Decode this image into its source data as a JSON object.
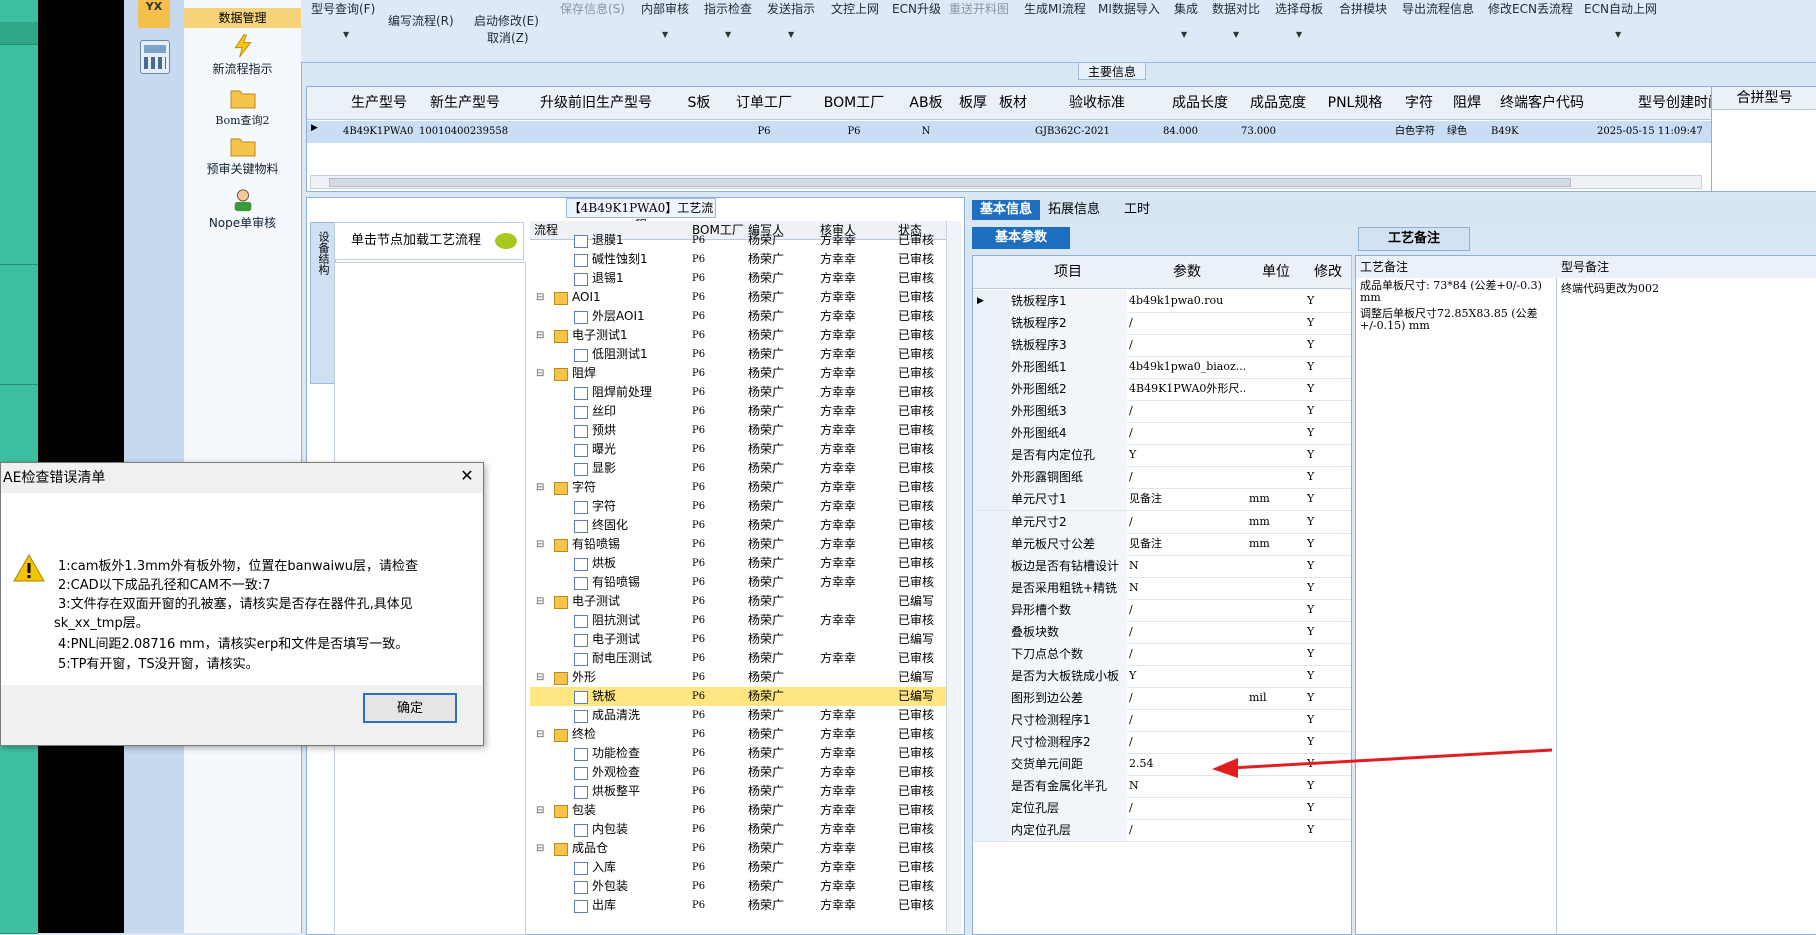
{
  "nav": {
    "top_label": "数据管理",
    "items": [
      {
        "label": "新流程指示",
        "icon": "lightning-icon"
      },
      {
        "label": "Bom查询2",
        "icon": "folder-icon"
      },
      {
        "label": "预审关键物料",
        "icon": "folder-icon"
      },
      {
        "label": "Nope单审核",
        "icon": "user-icon"
      }
    ]
  },
  "toolbar": {
    "model_query": "型号查询(F)",
    "edit_flow": "编写流程(R)",
    "start_edit": "启动修改(E)",
    "cancel": "取消(Z)",
    "save_info": "保存信息(S)",
    "internal_review": "内部审核",
    "indicator_check": "指示检查",
    "send_indicator": "发送指示",
    "doc_upload": "文控上网",
    "ecn_upgrade": "ECN升级",
    "resend_drill": "重送开料图",
    "gen_mi_flow": "生成MI流程",
    "mi_import": "MI数据导入",
    "integrate": "集成",
    "data_compare": "数据对比",
    "select_board": "选择母板",
    "merge_module": "合拼模块",
    "export_flow": "导出流程信息",
    "fix_ecn": "修改ECN丢流程",
    "ecn_auto": "ECN自动上网"
  },
  "main_info": {
    "title": "主要信息",
    "merge_label": "合拼型号",
    "headers": [
      "生产型号",
      "新生产型号",
      "升级前旧生产型号",
      "S板",
      "订单工厂",
      "BOM工厂",
      "AB板",
      "板厚",
      "板材",
      "验收标准",
      "成品长度",
      "成品宽度",
      "PNL规格",
      "字符",
      "阻焊",
      "终端客户代码",
      "型号创建时间"
    ],
    "row": [
      "4B49K1PWA0",
      "10010400239558",
      "",
      "",
      "P6",
      "P6",
      "N",
      "",
      "",
      "GJB362C-2021",
      "84.000",
      "73.000",
      "",
      "白色字符",
      "绿色",
      "B49K",
      "2025-05-15 11:09:47"
    ]
  },
  "process": {
    "title": "【4B49K1PWA0】工艺流程",
    "side_tab": "设备结构",
    "node_hint": "单击节点加载工艺流程",
    "headers": [
      "流程",
      "BOM工厂",
      "编写人",
      "核审人",
      "状态"
    ],
    "rows": [
      {
        "name": "退膜1",
        "level": 2,
        "factory": "P6",
        "writer": "杨荣广",
        "reviewer": "方幸幸",
        "status": "已审核"
      },
      {
        "name": "碱性蚀刻1",
        "level": 2,
        "factory": "P6",
        "writer": "杨荣广",
        "reviewer": "方幸幸",
        "status": "已审核"
      },
      {
        "name": "退锡1",
        "level": 2,
        "factory": "P6",
        "writer": "杨荣广",
        "reviewer": "方幸幸",
        "status": "已审核"
      },
      {
        "name": "AOI1",
        "level": 1,
        "factory": "P6",
        "writer": "杨荣广",
        "reviewer": "方幸幸",
        "status": "已审核"
      },
      {
        "name": "外层AOI1",
        "level": 2,
        "factory": "P6",
        "writer": "杨荣广",
        "reviewer": "方幸幸",
        "status": "已审核"
      },
      {
        "name": "电子测试1",
        "level": 1,
        "factory": "P6",
        "writer": "杨荣广",
        "reviewer": "方幸幸",
        "status": "已审核"
      },
      {
        "name": "低阻测试1",
        "level": 2,
        "factory": "P6",
        "writer": "杨荣广",
        "reviewer": "方幸幸",
        "status": "已审核"
      },
      {
        "name": "阻焊",
        "level": 1,
        "factory": "P6",
        "writer": "杨荣广",
        "reviewer": "方幸幸",
        "status": "已审核"
      },
      {
        "name": "阻焊前处理",
        "level": 2,
        "factory": "P6",
        "writer": "杨荣广",
        "reviewer": "方幸幸",
        "status": "已审核"
      },
      {
        "name": "丝印",
        "level": 2,
        "factory": "P6",
        "writer": "杨荣广",
        "reviewer": "方幸幸",
        "status": "已审核"
      },
      {
        "name": "预烘",
        "level": 2,
        "factory": "P6",
        "writer": "杨荣广",
        "reviewer": "方幸幸",
        "status": "已审核"
      },
      {
        "name": "曝光",
        "level": 2,
        "factory": "P6",
        "writer": "杨荣广",
        "reviewer": "方幸幸",
        "status": "已审核"
      },
      {
        "name": "显影",
        "level": 2,
        "factory": "P6",
        "writer": "杨荣广",
        "reviewer": "方幸幸",
        "status": "已审核"
      },
      {
        "name": "字符",
        "level": 1,
        "factory": "P6",
        "writer": "杨荣广",
        "reviewer": "方幸幸",
        "status": "已审核"
      },
      {
        "name": "字符",
        "level": 2,
        "factory": "P6",
        "writer": "杨荣广",
        "reviewer": "方幸幸",
        "status": "已审核"
      },
      {
        "name": "终固化",
        "level": 2,
        "factory": "P6",
        "writer": "杨荣广",
        "reviewer": "方幸幸",
        "status": "已审核"
      },
      {
        "name": "有铅喷锡",
        "level": 1,
        "factory": "P6",
        "writer": "杨荣广",
        "reviewer": "方幸幸",
        "status": "已审核"
      },
      {
        "name": "烘板",
        "level": 2,
        "factory": "P6",
        "writer": "杨荣广",
        "reviewer": "方幸幸",
        "status": "已审核"
      },
      {
        "name": "有铅喷锡",
        "level": 2,
        "factory": "P6",
        "writer": "杨荣广",
        "reviewer": "方幸幸",
        "status": "已审核"
      },
      {
        "name": "电子测试",
        "level": 1,
        "factory": "P6",
        "writer": "杨荣广",
        "reviewer": "",
        "status": "已编写"
      },
      {
        "name": "阻抗测试",
        "level": 2,
        "factory": "P6",
        "writer": "杨荣广",
        "reviewer": "方幸幸",
        "status": "已审核"
      },
      {
        "name": "电子测试",
        "level": 2,
        "factory": "P6",
        "writer": "杨荣广",
        "reviewer": "",
        "status": "已编写"
      },
      {
        "name": "耐电压测试",
        "level": 2,
        "factory": "P6",
        "writer": "杨荣广",
        "reviewer": "方幸幸",
        "status": "已审核"
      },
      {
        "name": "外形",
        "level": 1,
        "factory": "P6",
        "writer": "杨荣广",
        "reviewer": "",
        "status": "已编写"
      },
      {
        "name": "铣板",
        "level": 2,
        "factory": "P6",
        "writer": "杨荣广",
        "reviewer": "",
        "status": "已编写",
        "selected": true
      },
      {
        "name": "成品清洗",
        "level": 2,
        "factory": "P6",
        "writer": "杨荣广",
        "reviewer": "方幸幸",
        "status": "已审核"
      },
      {
        "name": "终检",
        "level": 1,
        "factory": "P6",
        "writer": "杨荣广",
        "reviewer": "方幸幸",
        "status": "已审核"
      },
      {
        "name": "功能检查",
        "level": 2,
        "factory": "P6",
        "writer": "杨荣广",
        "reviewer": "方幸幸",
        "status": "已审核"
      },
      {
        "name": "外观检查",
        "level": 2,
        "factory": "P6",
        "writer": "杨荣广",
        "reviewer": "方幸幸",
        "status": "已审核"
      },
      {
        "name": "烘板整平",
        "level": 2,
        "factory": "P6",
        "writer": "杨荣广",
        "reviewer": "方幸幸",
        "status": "已审核"
      },
      {
        "name": "包装",
        "level": 1,
        "factory": "P6",
        "writer": "杨荣广",
        "reviewer": "方幸幸",
        "status": "已审核"
      },
      {
        "name": "内包装",
        "level": 2,
        "factory": "P6",
        "writer": "杨荣广",
        "reviewer": "方幸幸",
        "status": "已审核"
      },
      {
        "name": "成品仓",
        "level": 1,
        "factory": "P6",
        "writer": "杨荣广",
        "reviewer": "方幸幸",
        "status": "已审核"
      },
      {
        "name": "入库",
        "level": 2,
        "factory": "P6",
        "writer": "杨荣广",
        "reviewer": "方幸幸",
        "status": "已审核"
      },
      {
        "name": "外包装",
        "level": 2,
        "factory": "P6",
        "writer": "杨荣广",
        "reviewer": "方幸幸",
        "status": "已审核"
      },
      {
        "name": "出库",
        "level": 2,
        "factory": "P6",
        "writer": "杨荣广",
        "reviewer": "方幸幸",
        "status": "已审核"
      }
    ]
  },
  "right_tabs": [
    "基本信息",
    "拓展信息",
    "工时"
  ],
  "basic_params": {
    "tab": "基本参数",
    "headers": [
      "项目",
      "参数",
      "单位",
      "修改"
    ],
    "rows": [
      {
        "item": "铣板程序1",
        "param": "4b49k1pwa0.rou",
        "unit": "",
        "mod": "Y"
      },
      {
        "item": "铣板程序2",
        "param": "/",
        "unit": "",
        "mod": "Y"
      },
      {
        "item": "铣板程序3",
        "param": "/",
        "unit": "",
        "mod": "Y"
      },
      {
        "item": "外形图纸1",
        "param": "4b49k1pwa0_biaoz...",
        "unit": "",
        "mod": "Y"
      },
      {
        "item": "外形图纸2",
        "param": "4B49K1PWA0外形尺...",
        "unit": "",
        "mod": "Y"
      },
      {
        "item": "外形图纸3",
        "param": "/",
        "unit": "",
        "mod": "Y"
      },
      {
        "item": "外形图纸4",
        "param": "/",
        "unit": "",
        "mod": "Y"
      },
      {
        "item": "是否有内定位孔",
        "param": "Y",
        "unit": "",
        "mod": "Y"
      },
      {
        "item": "外形露铜图纸",
        "param": "/",
        "unit": "",
        "mod": "Y"
      },
      {
        "item": "单元尺寸1",
        "param": "见备注",
        "unit": "mm",
        "mod": "Y"
      },
      {
        "item": "单元尺寸2",
        "param": "/",
        "unit": "mm",
        "mod": "Y"
      },
      {
        "item": "单元板尺寸公差",
        "param": "见备注",
        "unit": "mm",
        "mod": "Y"
      },
      {
        "item": "板边是否有钻槽设计",
        "param": "N",
        "unit": "",
        "mod": "Y"
      },
      {
        "item": "是否采用粗铣+精铣",
        "param": "N",
        "unit": "",
        "mod": "Y"
      },
      {
        "item": "异形槽个数",
        "param": "/",
        "unit": "",
        "mod": "Y"
      },
      {
        "item": "叠板块数",
        "param": "/",
        "unit": "",
        "mod": "Y"
      },
      {
        "item": "下刀点总个数",
        "param": "/",
        "unit": "",
        "mod": "Y"
      },
      {
        "item": "是否为大板铣成小板",
        "param": "Y",
        "unit": "",
        "mod": "Y"
      },
      {
        "item": "图形到边公差",
        "param": "/",
        "unit": "mil",
        "mod": "Y"
      },
      {
        "item": "尺寸检测程序1",
        "param": "/",
        "unit": "",
        "mod": "Y"
      },
      {
        "item": "尺寸检测程序2",
        "param": "/",
        "unit": "",
        "mod": "Y"
      },
      {
        "item": "交货单元间距",
        "param": "2.54",
        "unit": "",
        "mod": "Y"
      },
      {
        "item": "是否有金属化半孔",
        "param": "N",
        "unit": "",
        "mod": "Y"
      },
      {
        "item": "定位孔层",
        "param": "/",
        "unit": "",
        "mod": "Y"
      },
      {
        "item": "内定位孔层",
        "param": "/",
        "unit": "",
        "mod": "Y"
      }
    ]
  },
  "craft": {
    "tab": "工艺备注",
    "col1_header": "工艺备注",
    "col2_header": "型号备注",
    "note1": "成品单板尺寸: 73*84 (公差+0/-0.3) mm",
    "note2": "调整后单板尺寸72.85X83.85 (公差+/-0.15) mm",
    "model_note": "终端代码更改为002"
  },
  "dialog": {
    "title": "AE检查错误清单",
    "close": "✕",
    "lines": [
      "1:cam板外1.3mm外有板外物，位置在banwaiwu层，请检查",
      "2:CAD以下成品孔径和CAM不一致:7",
      "3:文件存在双面开窗的孔被塞，请核实是否存在器件孔,具体见",
      "sk_xx_tmp层。",
      "4:PNL间距2.08716 mm，请核实erp和文件是否填写一致。",
      "5:TP有开窗，TS没开窗，请核实。"
    ],
    "ok": "确定"
  },
  "colors": {
    "accent": "#1f6fc0",
    "selected_row": "#ffe680",
    "annotation_arrow": "#e02020"
  }
}
